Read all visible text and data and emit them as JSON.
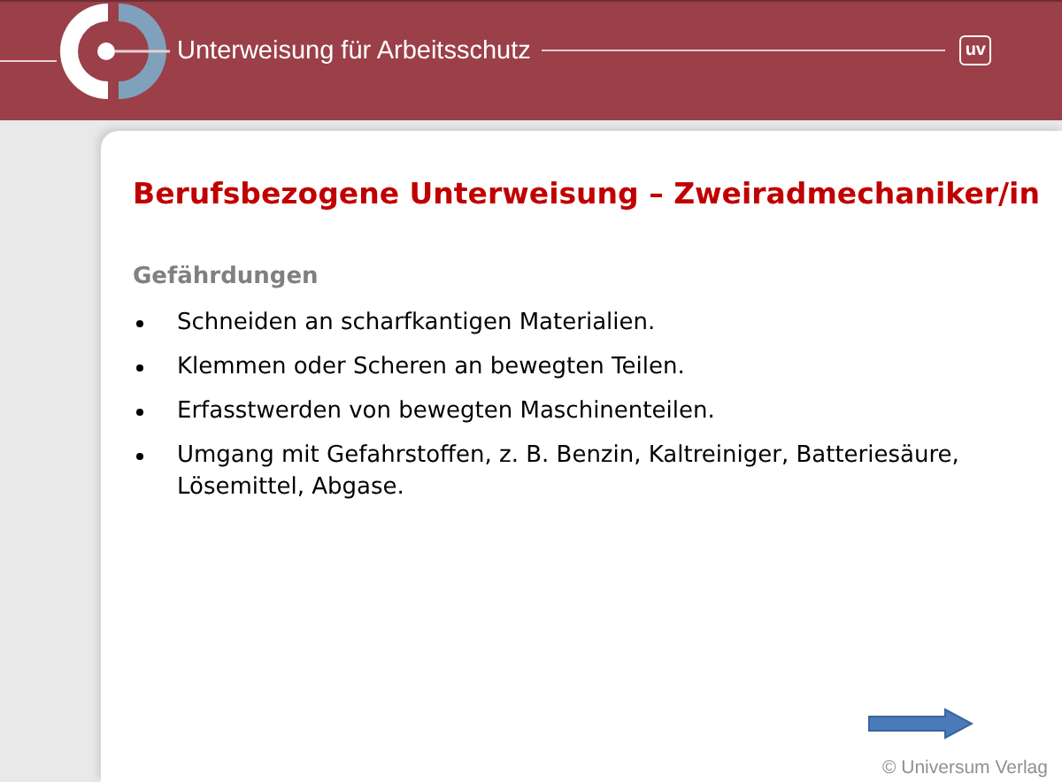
{
  "header": {
    "title": "Unterweisung für Arbeitsschutz",
    "badge": "uv"
  },
  "slide": {
    "title": "Berufsbezogene Unterweisung – Zweiradmechaniker/in",
    "section": "Gefährdungen",
    "bullets": [
      "Schneiden an scharfkantigen Materialien.",
      "Klemmen oder Scheren an bewegten Teilen.",
      "Erfasstwerden von bewegten Maschinenteilen.",
      "Umgang mit Gefahrstoffen, z. B. Benzin, Kaltreiniger, Batteriesäure, Lösemittel, Abgase."
    ]
  },
  "footer": {
    "copyright": "© Universum Verlag"
  }
}
